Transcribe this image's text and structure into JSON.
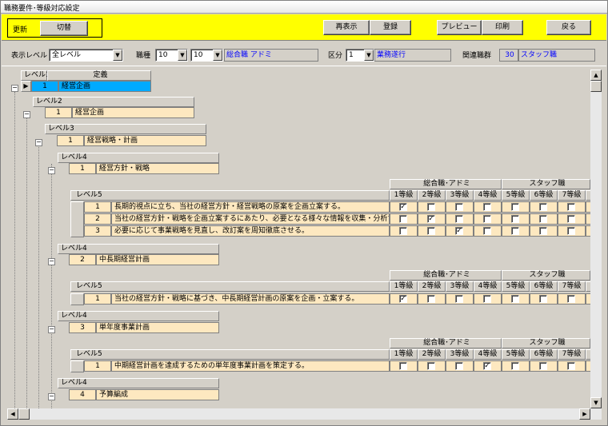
{
  "window": {
    "title": "職務要件･等級対応設定"
  },
  "toolbar": {
    "update_label": "更新",
    "switch_label": "切替",
    "refresh_label": "再表示",
    "register_label": "登録",
    "preview_label": "プレビュー",
    "print_label": "印刷",
    "back_label": "戻る"
  },
  "filters": {
    "level_label": "表示レベル",
    "level_value": "全レベル",
    "job_label": "職種",
    "job_from": "10",
    "job_to": "10",
    "job_name": "総合職 アドミ",
    "division_label": "区分",
    "division_value": "1",
    "division_name": "業務遂行",
    "related_label": "関連職群",
    "related_code": "30",
    "related_name": "スタッフ職"
  },
  "tree": {
    "level1": {
      "header": "レベル1",
      "def_header": "定義",
      "num": "1",
      "name": "経営企画"
    },
    "level2": {
      "header": "レベル2",
      "num": "1",
      "name": "経営企画"
    },
    "level3": {
      "header": "レベル3",
      "num": "1",
      "name": "経営戦略・計画"
    },
    "level4a": {
      "header": "レベル4",
      "num": "1",
      "name": "経営方針・戦略"
    },
    "level4b": {
      "header": "レベル4",
      "num": "2",
      "name": "中長期経営計画"
    },
    "level4c": {
      "header": "レベル4",
      "num": "3",
      "name": "単年度事業計画"
    },
    "level4d": {
      "header": "レベル4",
      "num": "4",
      "name": "予算編成"
    }
  },
  "grades": {
    "group1": "総合職･アドミ",
    "group2": "スタッフ職",
    "level5_header": "レベル5",
    "g1": "1等級",
    "g2": "2等級",
    "g3": "3等級",
    "g4": "4等級",
    "g5": "5等級",
    "g6": "6等級",
    "g7": "7等級"
  },
  "tableA": [
    {
      "num": "1",
      "text": "長期的視点に立ち、当社の経営方針・経営戦略の原案を企画立案する。"
    },
    {
      "num": "2",
      "text": "当社の経営方針・戦略を企画立案するにあたり、必要となる様々な情報を収集・分析する"
    },
    {
      "num": "3",
      "text": "必要に応じて事業戦略を見直し、改訂案を周知徹底させる。"
    }
  ],
  "tableB": [
    {
      "num": "1",
      "text": "当社の経営方針・戦略に基づき、中長期経営計画の原案を企画・立案する。"
    }
  ],
  "tableC": [
    {
      "num": "1",
      "text": "中期経営計画を達成するための単年度事業計画を策定する。"
    }
  ],
  "checks": {
    "tableA": [
      [
        true,
        false,
        false,
        false,
        false,
        false,
        false
      ],
      [
        false,
        true,
        false,
        false,
        false,
        false,
        false
      ],
      [
        false,
        false,
        true,
        false,
        false,
        false,
        false
      ]
    ],
    "tableB": [
      [
        true,
        false,
        false,
        false,
        false,
        false,
        false
      ]
    ],
    "tableC": [
      [
        false,
        false,
        false,
        true,
        false,
        false,
        false
      ]
    ]
  },
  "colors": {
    "toolbar_bg": "#ffff00",
    "selected_row": "#00aaff",
    "level_cell": "#fde8c0",
    "value_text": "#0000ff"
  }
}
